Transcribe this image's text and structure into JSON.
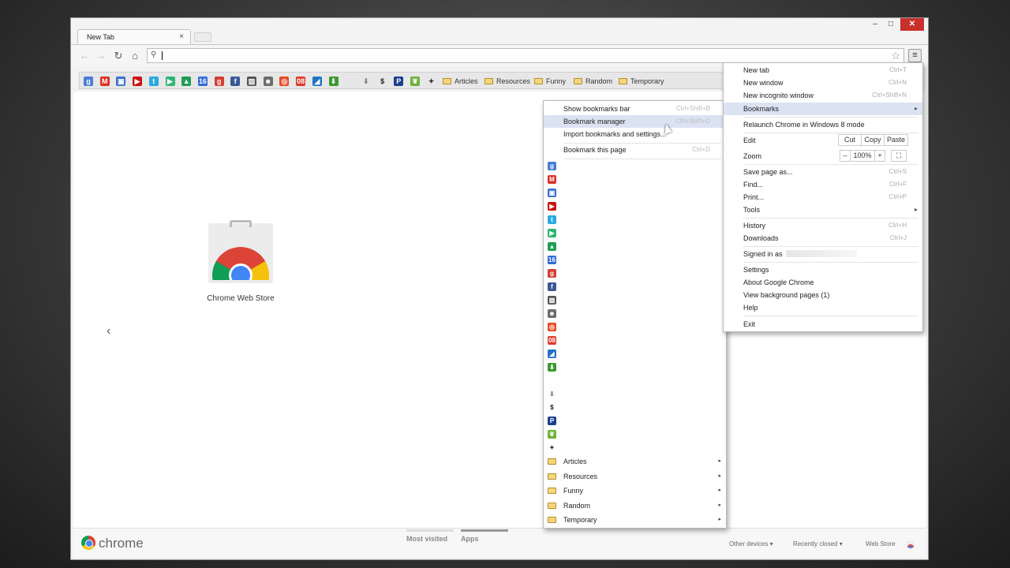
{
  "tab": {
    "title": "New Tab",
    "close": "×"
  },
  "window_controls": {
    "minimize": "–",
    "maximize": "□",
    "close": "✕"
  },
  "toolbar": {
    "back_icon": "back-arrow-icon",
    "forward_icon": "forward-arrow-icon",
    "reload_icon": "reload-icon",
    "home_icon": "home-icon",
    "omnibox_value": "",
    "menu_icon": "hamburger-menu-icon"
  },
  "bookmarks_bar": {
    "icons": [
      {
        "name": "google",
        "glyph": "g",
        "color": "#4a7cd9"
      },
      {
        "name": "gmail",
        "glyph": "M",
        "color": "#d93025"
      },
      {
        "name": "docs-stack",
        "glyph": "▣",
        "color": "#3b6fd0"
      },
      {
        "name": "youtube",
        "glyph": "▶",
        "color": "#cc1111"
      },
      {
        "name": "twitter",
        "glyph": "t",
        "color": "#2aa9e0"
      },
      {
        "name": "play",
        "glyph": "▶",
        "color": "#2bb673"
      },
      {
        "name": "drive",
        "glyph": "▲",
        "color": "#1e9c55"
      },
      {
        "name": "calendar",
        "glyph": "16",
        "color": "#2e6ad6"
      },
      {
        "name": "google-plus",
        "glyph": "g",
        "color": "#d23f31"
      },
      {
        "name": "facebook",
        "glyph": "f",
        "color": "#3b5998"
      },
      {
        "name": "photos",
        "glyph": "▨",
        "color": "#555555"
      },
      {
        "name": "reddit",
        "glyph": "☻",
        "color": "#6d6d6d"
      },
      {
        "name": "stumbleupon",
        "glyph": "◎",
        "color": "#eb4924"
      },
      {
        "name": "office",
        "glyph": "08",
        "color": "#e03a2a"
      },
      {
        "name": "blue-app",
        "glyph": "◢",
        "color": "#2273c8"
      },
      {
        "name": "download-green",
        "glyph": "⬇",
        "color": "#3c9a2e"
      },
      {
        "name": "blank-app",
        "glyph": "",
        "color": "#dddddd"
      },
      {
        "name": "arrow-down-gray",
        "glyph": "⬇",
        "color": "#888888"
      },
      {
        "name": "dollar",
        "glyph": "$",
        "color": "#222222"
      },
      {
        "name": "paypal",
        "glyph": "P",
        "color": "#1d3f8f"
      },
      {
        "name": "leaf",
        "glyph": "❦",
        "color": "#6fb23a"
      },
      {
        "name": "pin",
        "glyph": "✦",
        "color": "#333333"
      }
    ],
    "folders": [
      "Articles",
      "Resources",
      "Funny",
      "Random",
      "Temporary"
    ]
  },
  "content": {
    "app_label": "Chrome Web Store",
    "prev_arrow": "‹"
  },
  "footer": {
    "logo_text": "chrome",
    "tabs": [
      "Most visited",
      "Apps"
    ],
    "links": [
      "Other devices ▾",
      "Recently closed ▾",
      "Web Store"
    ]
  },
  "main_menu": {
    "items": [
      {
        "label": "New tab",
        "shortcut": "Ctrl+T"
      },
      {
        "label": "New window",
        "shortcut": "Ctrl+N"
      },
      {
        "label": "New incognito window",
        "shortcut": "Ctrl+Shift+N"
      },
      {
        "label": "Bookmarks",
        "shortcut": "▸"
      },
      {
        "label": "Relaunch Chrome in Windows 8 mode",
        "shortcut": ""
      },
      {
        "label": "Edit",
        "shortcut": ""
      },
      {
        "label": "Zoom",
        "shortcut": ""
      },
      {
        "label": "Save page as...",
        "shortcut": "Ctrl+S"
      },
      {
        "label": "Find...",
        "shortcut": "Ctrl+F"
      },
      {
        "label": "Print...",
        "shortcut": "Ctrl+P"
      },
      {
        "label": "Tools",
        "shortcut": "▸"
      },
      {
        "label": "History",
        "shortcut": "Ctrl+H"
      },
      {
        "label": "Downloads",
        "shortcut": "Ctrl+J"
      },
      {
        "label": "Signed in as",
        "shortcut": ""
      },
      {
        "label": "Settings",
        "shortcut": ""
      },
      {
        "label": "About Google Chrome",
        "shortcut": ""
      },
      {
        "label": "View background pages (1)",
        "shortcut": ""
      },
      {
        "label": "Help",
        "shortcut": ""
      },
      {
        "label": "Exit",
        "shortcut": ""
      }
    ],
    "edit_buttons": [
      "Cut",
      "Copy",
      "Paste"
    ],
    "zoom": {
      "minus": "–",
      "value": "100%",
      "plus": "+",
      "fullscreen": "⛶"
    },
    "highlight_color": "#dbe3f3"
  },
  "bookmarks_submenu": {
    "items": [
      {
        "label": "Show bookmarks bar",
        "shortcut": "Ctrl+Shift+B"
      },
      {
        "label": "Bookmark manager",
        "shortcut": "Ctrl+Shift+O"
      },
      {
        "label": "Import bookmarks and settings...",
        "shortcut": ""
      },
      {
        "label": "Bookmark this page",
        "shortcut": "Ctrl+D"
      }
    ],
    "folders": [
      "Articles",
      "Resources",
      "Funny",
      "Random",
      "Temporary"
    ]
  }
}
